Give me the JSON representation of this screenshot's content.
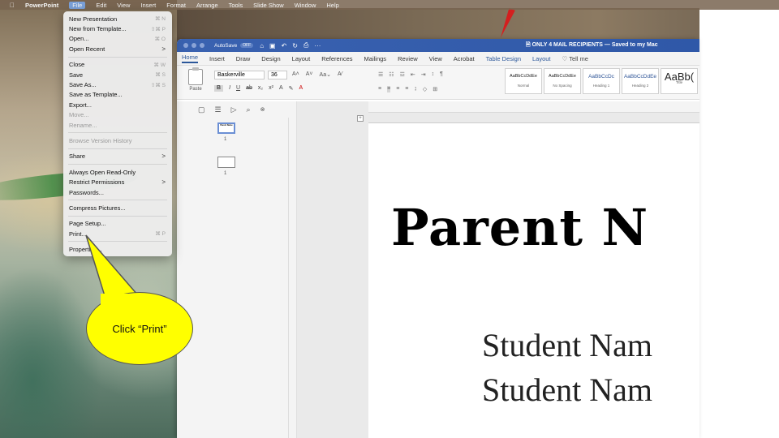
{
  "menubar": {
    "apple": "",
    "app": "PowerPoint",
    "items": [
      "File",
      "Edit",
      "View",
      "Insert",
      "Format",
      "Arrange",
      "Tools",
      "Slide Show",
      "Window",
      "Help"
    ]
  },
  "file_menu": [
    {
      "label": "New Presentation",
      "shortcut": "⌘ N"
    },
    {
      "label": "New from Template...",
      "shortcut": "⇧⌘ P"
    },
    {
      "label": "Open...",
      "shortcut": "⌘ O"
    },
    {
      "label": "Open Recent",
      "shortcut": ">"
    },
    {
      "label": "Close",
      "shortcut": "⌘ W"
    },
    {
      "label": "Save",
      "shortcut": "⌘ S"
    },
    {
      "label": "Save As...",
      "shortcut": "⇧⌘ S"
    },
    {
      "label": "Save as Template...",
      "shortcut": ""
    },
    {
      "label": "Export...",
      "shortcut": ""
    },
    {
      "label": "Move...",
      "shortcut": ""
    },
    {
      "label": "Rename...",
      "shortcut": ""
    },
    {
      "label": "Browse Version History",
      "shortcut": ""
    },
    {
      "label": "Share",
      "shortcut": ">"
    },
    {
      "label": "Always Open Read-Only",
      "shortcut": ""
    },
    {
      "label": "Restrict Permissions",
      "shortcut": ">"
    },
    {
      "label": "Passwords...",
      "shortcut": ""
    },
    {
      "label": "Compress Pictures...",
      "shortcut": ""
    },
    {
      "label": "Page Setup...",
      "shortcut": ""
    },
    {
      "label": "Print...",
      "shortcut": "⌘ P"
    },
    {
      "label": "Properties...",
      "shortcut": ""
    }
  ],
  "window": {
    "autosave": "AutoSave",
    "autosave_state": "OFF",
    "title": "ONLY 4 MAIL RECIPIENTS — Saved to my Mac",
    "tabs": [
      "Home",
      "Insert",
      "Draw",
      "Design",
      "Layout",
      "References",
      "Mailings",
      "Review",
      "View",
      "Acrobat",
      "Table Design",
      "Layout"
    ],
    "tell_me": "Tell me",
    "paste": "Paste",
    "font": "Baskerville",
    "font_size": "36",
    "styles": [
      {
        "sample": "AaBbCcDdEe",
        "name": "Normal"
      },
      {
        "sample": "AaBbCcDdEe",
        "name": "No Spacing"
      },
      {
        "sample": "AaBbCcDc",
        "name": "Heading 1"
      },
      {
        "sample": "AaBbCcDdEe",
        "name": "Heading 2"
      },
      {
        "sample": "AaBb(",
        "name": "Title"
      }
    ],
    "thumb_text": "Parent Name",
    "thumb_nums": [
      "1",
      "1"
    ]
  },
  "document": {
    "heading": "Parent N",
    "students": [
      "Student Nam",
      "Student Nam"
    ]
  },
  "callout": {
    "text": "Click “Print”"
  }
}
